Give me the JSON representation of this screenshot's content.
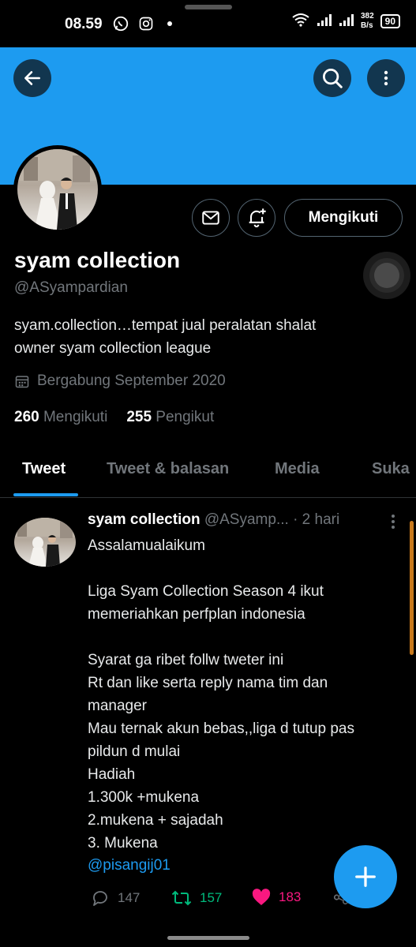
{
  "status_bar": {
    "time": "08.59",
    "speed_value": "382",
    "speed_unit": "B/s",
    "battery": "90",
    "icons": [
      "whatsapp-icon",
      "instagram-icon",
      "dot-icon",
      "wifi-icon",
      "signal-icon",
      "signal-icon"
    ]
  },
  "colors": {
    "accent": "#1d9bf0",
    "retweet": "#00ba7c",
    "like": "#f91880",
    "muted": "#71767b",
    "background": "#000000"
  },
  "header": {
    "icons": [
      "back-arrow-icon",
      "search-icon",
      "more-vertical-icon"
    ]
  },
  "profile": {
    "name": "syam collection",
    "handle": "@ASyampardian",
    "bio_line1": "syam.collection…tempat jual peralatan shalat",
    "bio_line2": "owner syam collection league",
    "joined": "Bergabung September 2020",
    "following_count": "260",
    "following_label": "Mengikuti",
    "followers_count": "255",
    "followers_label": "Pengikut",
    "follow_button": "Mengikuti"
  },
  "tabs": [
    {
      "label": "Tweet",
      "active": true
    },
    {
      "label": "Tweet & balasan",
      "active": false
    },
    {
      "label": "Media",
      "active": false
    },
    {
      "label": "Suka",
      "active": false
    }
  ],
  "tweet": {
    "name": "syam collection",
    "handle": "@ASyamp...",
    "time": "· 2 hari",
    "text": "Assalamualaikum\n\nLiga Syam Collection Season 4 ikut\nmemeriahkan perfplan indonesia\n\nSyarat ga ribet follw tweter ini\nRt dan like serta reply nama tim dan\nmanager\nMau ternak akun bebas,,liga d tutup pas\npildun d mulai\nHadiah\n1.300k +mukena\n2.mukena + sajadah\n3. Mukena",
    "mention": "@pisangij01",
    "replies": "147",
    "retweets": "157",
    "likes": "183"
  }
}
